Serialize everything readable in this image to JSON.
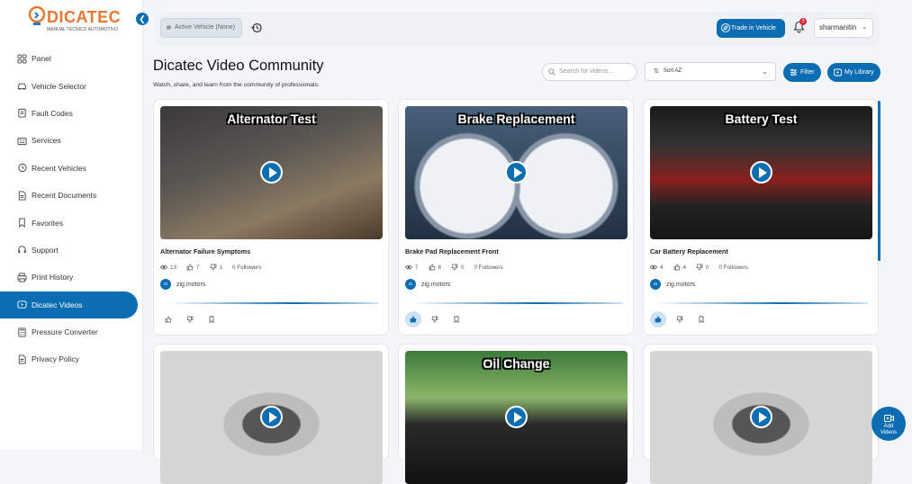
{
  "app": {
    "brand": "DICATEC",
    "tagline": "MANUAL TÉCNICO AUTOMOTIVO"
  },
  "sidebar": {
    "items": [
      {
        "label": "Panel",
        "icon": "grid-icon"
      },
      {
        "label": "Vehicle Selector",
        "icon": "car-icon"
      },
      {
        "label": "Fault Codes",
        "icon": "clipboard-icon"
      },
      {
        "label": "Services",
        "icon": "toolbox-icon"
      },
      {
        "label": "Recent Vehicles",
        "icon": "history-icon"
      },
      {
        "label": "Recent Documents",
        "icon": "document-icon"
      },
      {
        "label": "Favorites",
        "icon": "bookmark-icon"
      },
      {
        "label": "Support",
        "icon": "headset-icon"
      },
      {
        "label": "Print History",
        "icon": "printer-icon"
      },
      {
        "label": "Dicatec Videos",
        "icon": "video-icon",
        "active": true
      },
      {
        "label": "Pressure Converter",
        "icon": "calculator-icon"
      },
      {
        "label": "Privacy Policy",
        "icon": "document-icon"
      }
    ]
  },
  "topbar": {
    "active_vehicle": "Active Vehicle (None)",
    "trade_label": "Trade in Vehicle",
    "notification_count": "3",
    "username": "sharmanitin"
  },
  "page": {
    "title": "Dicatec Video Community",
    "subtitle": "Watch, share, and learn from the community of professionals.",
    "search_placeholder": "Search for videos...",
    "sort_value": "Sort AZ",
    "filter_label": "Filter",
    "library_label": "My Library"
  },
  "videos": [
    {
      "thumb_text": "Alternator Test",
      "title": "Alternator Failure Symptoms",
      "views": "13",
      "likes": "7",
      "dislikes": "1",
      "followers": "0 Followers",
      "channel": "zig.motors",
      "avatar": "ZI",
      "liked": false
    },
    {
      "thumb_text": "Brake Replacement",
      "title": "Brake Pad Replacement Front",
      "views": "7",
      "likes": "8",
      "dislikes": "0",
      "followers": "0 Followers",
      "channel": "zig.motors",
      "avatar": "ZI",
      "liked": true
    },
    {
      "thumb_text": "Battery Test",
      "title": "Car Battery Replacement",
      "views": "4",
      "likes": "4",
      "dislikes": "0",
      "followers": "0 Followers",
      "channel": "zig.motors",
      "avatar": "ZI",
      "liked": true
    },
    {
      "thumb_text": ""
    },
    {
      "thumb_text": "Oil Change"
    },
    {
      "thumb_text": ""
    }
  ],
  "fab": {
    "line1": "Add",
    "line2": "Videos"
  },
  "colors": {
    "accent": "#0c6db3",
    "brand_orange": "#e8772e",
    "badge": "#d9283a"
  }
}
